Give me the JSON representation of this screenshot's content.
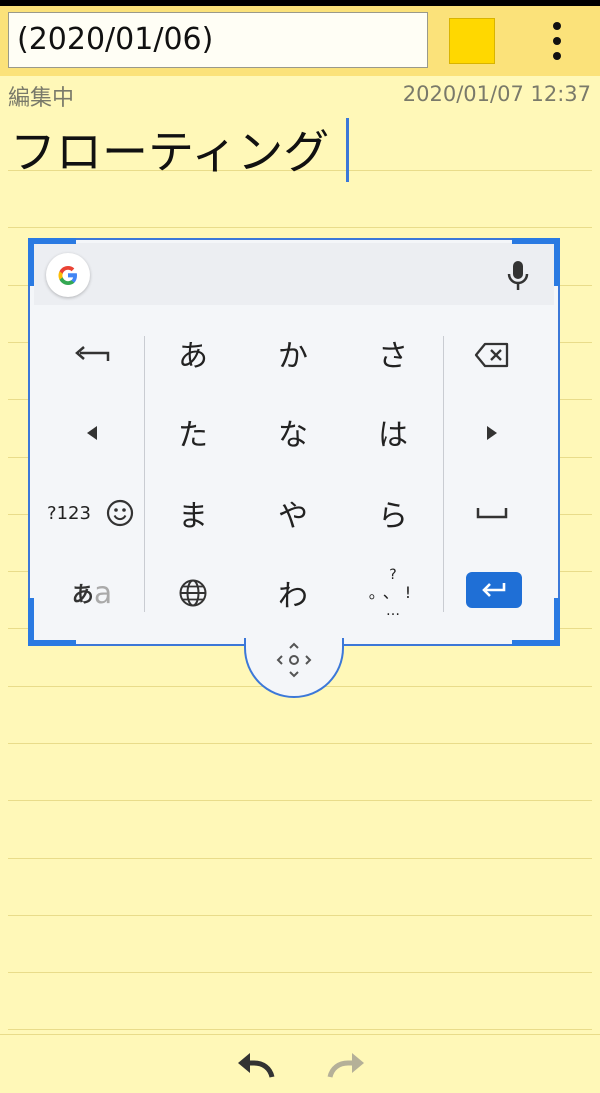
{
  "header": {
    "title_value": "(2020/01/06)",
    "swatch_color": "#ffd800"
  },
  "meta": {
    "status": "編集中",
    "timestamp": "2020/01/07 12:37"
  },
  "note": {
    "text": "フローティング"
  },
  "keyboard": {
    "rows": [
      [
        "あ",
        "か",
        "さ"
      ],
      [
        "た",
        "な",
        "は"
      ],
      [
        "ま",
        "や",
        "ら"
      ],
      [
        "",
        "わ",
        ""
      ]
    ],
    "left_keys": {
      "numbers": "?123",
      "kana_toggle_main": "あ",
      "kana_toggle_sub": "a"
    },
    "punct_key": {
      "top": "?",
      "middle": "。、!",
      "bottom": "…"
    },
    "accent_color": "#1f6fd6"
  },
  "icons": [
    "google-logo-icon",
    "mic-icon",
    "undo-arrow-icon",
    "backspace-icon",
    "left-arrow-icon",
    "right-arrow-icon",
    "emoji-icon",
    "space-icon",
    "globe-icon",
    "enter-icon",
    "move-handle-icon",
    "undo-icon",
    "redo-icon",
    "more-vert-icon"
  ]
}
